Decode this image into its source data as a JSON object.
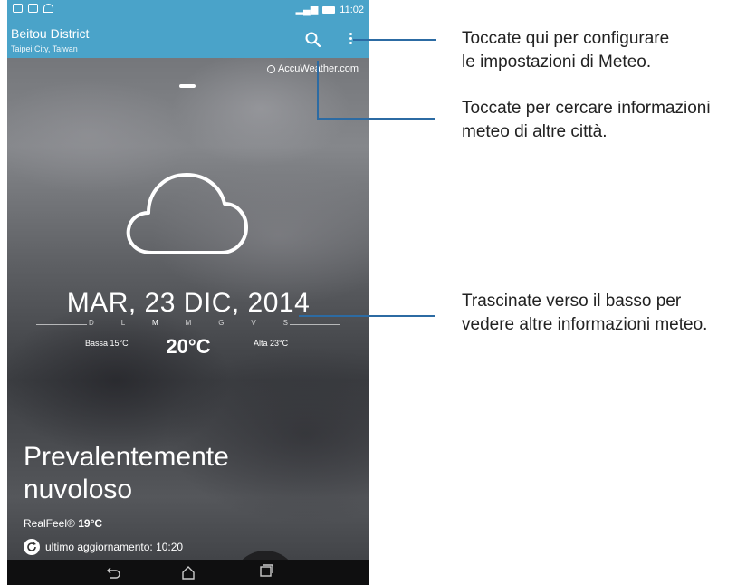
{
  "statusbar": {
    "time": "11:02"
  },
  "appbar": {
    "city": "Beitou District",
    "region": "Taipei City, Taiwan"
  },
  "provider": "AccuWeather.com",
  "weather": {
    "date": "MAR, 23 DIC, 2014",
    "days": [
      "D",
      "L",
      "M",
      "M",
      "G",
      "V",
      "S"
    ],
    "low": "Bassa 15°C",
    "high": "Alta 23°C",
    "temp": "20°C",
    "condition_line1": "Prevalentemente",
    "condition_line2": "nuvoloso",
    "realfeel_label": "RealFeel®",
    "realfeel_value": "19°C",
    "updated": "ultimo aggiornamento: 10:20"
  },
  "callouts": {
    "settings_line1": "Toccate qui per configurare",
    "settings_line2": "le impostazioni di Meteo.",
    "search_line1": "Toccate per cercare informazioni",
    "search_line2": "meteo di altre città.",
    "drag_line1": "Trascinate verso il basso per",
    "drag_line2": "vedere altre informazioni meteo."
  },
  "colors": {
    "accent": "#4aa3c9",
    "callout_line": "#2c6ba3"
  }
}
